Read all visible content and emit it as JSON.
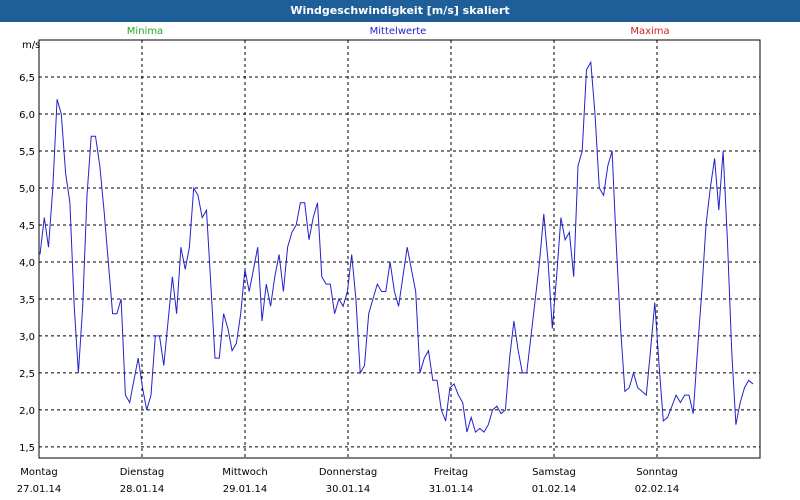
{
  "title": "Windgeschwindigkeit [m/s] skaliert",
  "legend": {
    "min": {
      "label": "Minima",
      "color": "#22aa22"
    },
    "mean": {
      "label": "Mittelwerte",
      "color": "#2222cc"
    },
    "max": {
      "label": "Maxima",
      "color": "#cc2222"
    }
  },
  "chart_data": {
    "type": "line",
    "title": "Windgeschwindigkeit [m/s] skaliert",
    "ylabel": "m/s",
    "xlabel": "",
    "ylim": [
      1.35,
      7.0
    ],
    "yticks": [
      1.5,
      2.0,
      2.5,
      3.0,
      3.5,
      4.0,
      4.5,
      5.0,
      5.5,
      6.0,
      6.5
    ],
    "grid": true,
    "x_categories": [
      {
        "day": "Montag",
        "date": "27.01.14"
      },
      {
        "day": "Dienstag",
        "date": "28.01.14"
      },
      {
        "day": "Mittwoch",
        "date": "29.01.14"
      },
      {
        "day": "Donnerstag",
        "date": "30.01.14"
      },
      {
        "day": "Freitag",
        "date": "31.01.14"
      },
      {
        "day": "Samstag",
        "date": "01.02.14"
      },
      {
        "day": "Sonntag",
        "date": "02.02.14"
      }
    ],
    "series": [
      {
        "name": "Mittelwerte",
        "color": "#2222cc",
        "values": [
          4.1,
          4.6,
          4.2,
          5.0,
          6.2,
          6.0,
          5.2,
          4.8,
          3.4,
          2.5,
          3.4,
          4.9,
          5.7,
          5.7,
          5.3,
          4.7,
          4.0,
          3.3,
          3.3,
          3.5,
          2.2,
          2.1,
          2.4,
          2.7,
          2.3,
          2.0,
          2.2,
          3.0,
          3.0,
          2.6,
          3.2,
          3.8,
          3.3,
          4.2,
          3.9,
          4.2,
          5.0,
          4.9,
          4.6,
          4.7,
          3.7,
          2.7,
          2.7,
          3.3,
          3.1,
          2.8,
          2.9,
          3.3,
          3.9,
          3.6,
          3.9,
          4.2,
          3.2,
          3.7,
          3.4,
          3.8,
          4.1,
          3.6,
          4.2,
          4.4,
          4.5,
          4.8,
          4.8,
          4.3,
          4.6,
          4.8,
          3.8,
          3.7,
          3.7,
          3.3,
          3.5,
          3.4,
          3.6,
          4.1,
          3.5,
          2.5,
          2.6,
          3.3,
          3.5,
          3.7,
          3.6,
          3.6,
          4.0,
          3.6,
          3.4,
          3.8,
          4.2,
          3.9,
          3.6,
          2.5,
          2.7,
          2.8,
          2.4,
          2.4,
          2.0,
          1.85,
          2.3,
          2.35,
          2.2,
          2.1,
          1.7,
          1.9,
          1.7,
          1.75,
          1.7,
          1.8,
          2.0,
          2.05,
          1.95,
          2.0,
          2.7,
          3.2,
          2.8,
          2.5,
          2.5,
          3.0,
          3.5,
          4.0,
          4.65,
          4.0,
          3.1,
          3.8,
          4.6,
          4.3,
          4.4,
          3.8,
          5.3,
          5.5,
          6.6,
          6.7,
          6.0,
          5.0,
          4.9,
          5.3,
          5.5,
          4.2,
          3.1,
          2.25,
          2.3,
          2.5,
          2.3,
          2.25,
          2.2,
          2.8,
          3.45,
          2.6,
          1.85,
          1.9,
          2.05,
          2.2,
          2.1,
          2.2,
          2.2,
          1.95,
          2.8,
          3.6,
          4.5,
          5.0,
          5.4,
          4.7,
          5.5,
          4.3,
          2.8,
          1.8,
          2.1,
          2.3,
          2.4,
          2.35
        ]
      }
    ]
  }
}
